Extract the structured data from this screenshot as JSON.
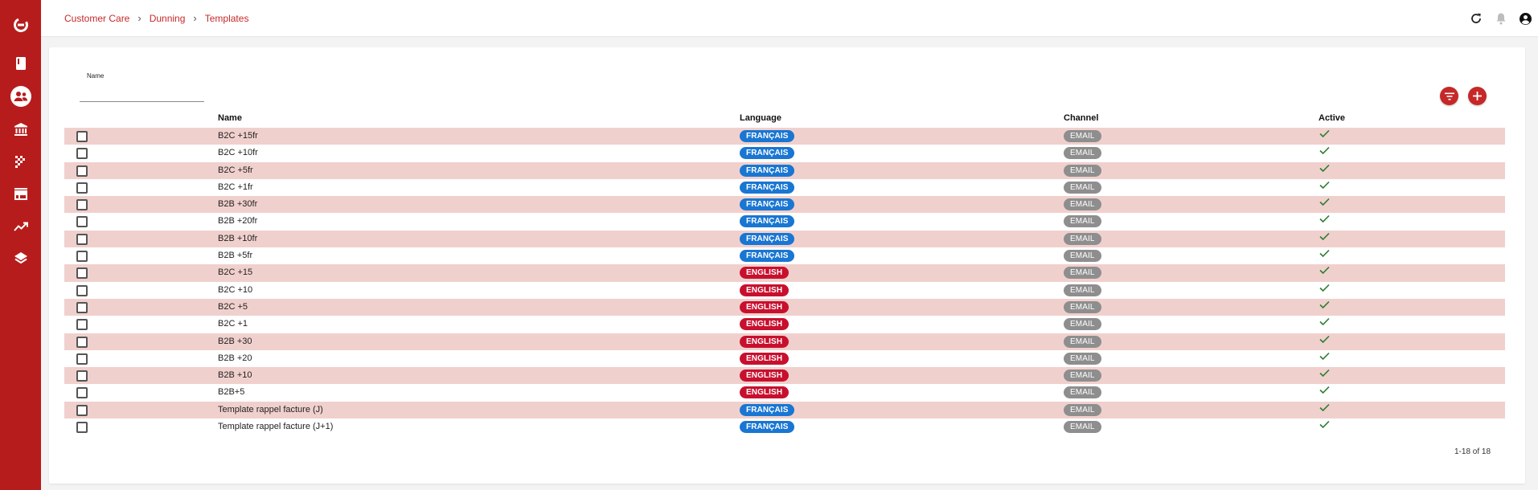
{
  "sidebar": {
    "items": [
      {
        "icon": "logo-icon"
      },
      {
        "icon": "book-icon"
      },
      {
        "icon": "customers-icon",
        "active": true
      },
      {
        "icon": "bank-icon"
      },
      {
        "icon": "grid-dots-icon"
      },
      {
        "icon": "store-icon"
      },
      {
        "icon": "trending-up-icon"
      },
      {
        "icon": "layers-icon"
      }
    ],
    "color": "#b71c1c"
  },
  "breadcrumb": [
    "Customer Care",
    "Dunning",
    "Templates"
  ],
  "header_actions": [
    "refresh-icon",
    "bell-icon",
    "account-icon"
  ],
  "filter": {
    "label": "Name",
    "value": ""
  },
  "actions": [
    "filter-list-icon",
    "add-icon"
  ],
  "table": {
    "columns": [
      "Name",
      "Language",
      "Channel",
      "Active"
    ],
    "rows": [
      {
        "name": "B2C +15fr",
        "language": "FRANÇAIS",
        "lang_code": "fr",
        "channel": "EMAIL",
        "active": true
      },
      {
        "name": "B2C +10fr",
        "language": "FRANÇAIS",
        "lang_code": "fr",
        "channel": "EMAIL",
        "active": true
      },
      {
        "name": "B2C +5fr",
        "language": "FRANÇAIS",
        "lang_code": "fr",
        "channel": "EMAIL",
        "active": true
      },
      {
        "name": "B2C +1fr",
        "language": "FRANÇAIS",
        "lang_code": "fr",
        "channel": "EMAIL",
        "active": true
      },
      {
        "name": "B2B +30fr",
        "language": "FRANÇAIS",
        "lang_code": "fr",
        "channel": "EMAIL",
        "active": true
      },
      {
        "name": "B2B +20fr",
        "language": "FRANÇAIS",
        "lang_code": "fr",
        "channel": "EMAIL",
        "active": true
      },
      {
        "name": "B2B +10fr",
        "language": "FRANÇAIS",
        "lang_code": "fr",
        "channel": "EMAIL",
        "active": true
      },
      {
        "name": "B2B +5fr",
        "language": "FRANÇAIS",
        "lang_code": "fr",
        "channel": "EMAIL",
        "active": true
      },
      {
        "name": "B2C +15",
        "language": "ENGLISH",
        "lang_code": "en",
        "channel": "EMAIL",
        "active": true
      },
      {
        "name": "B2C +10",
        "language": "ENGLISH",
        "lang_code": "en",
        "channel": "EMAIL",
        "active": true
      },
      {
        "name": "B2C +5",
        "language": "ENGLISH",
        "lang_code": "en",
        "channel": "EMAIL",
        "active": true
      },
      {
        "name": "B2C +1",
        "language": "ENGLISH",
        "lang_code": "en",
        "channel": "EMAIL",
        "active": true
      },
      {
        "name": "B2B +30",
        "language": "ENGLISH",
        "lang_code": "en",
        "channel": "EMAIL",
        "active": true
      },
      {
        "name": "B2B +20",
        "language": "ENGLISH",
        "lang_code": "en",
        "channel": "EMAIL",
        "active": true
      },
      {
        "name": "B2B +10",
        "language": "ENGLISH",
        "lang_code": "en",
        "channel": "EMAIL",
        "active": true
      },
      {
        "name": "B2B+5",
        "language": "ENGLISH",
        "lang_code": "en",
        "channel": "EMAIL",
        "active": true
      },
      {
        "name": "Template rappel facture (J)",
        "language": "FRANÇAIS",
        "lang_code": "fr",
        "channel": "EMAIL",
        "active": true
      },
      {
        "name": "Template rappel facture (J+1)",
        "language": "FRANÇAIS",
        "lang_code": "fr",
        "channel": "EMAIL",
        "active": true
      }
    ]
  },
  "pagination": "1-18 of 18",
  "colors": {
    "accent": "#c62828",
    "french_chip": "#1976d2",
    "english_chip": "#c8102e",
    "channel_chip": "#8e8e8e",
    "row_highlight": "#f0d0cd",
    "check": "#2e7d32"
  }
}
